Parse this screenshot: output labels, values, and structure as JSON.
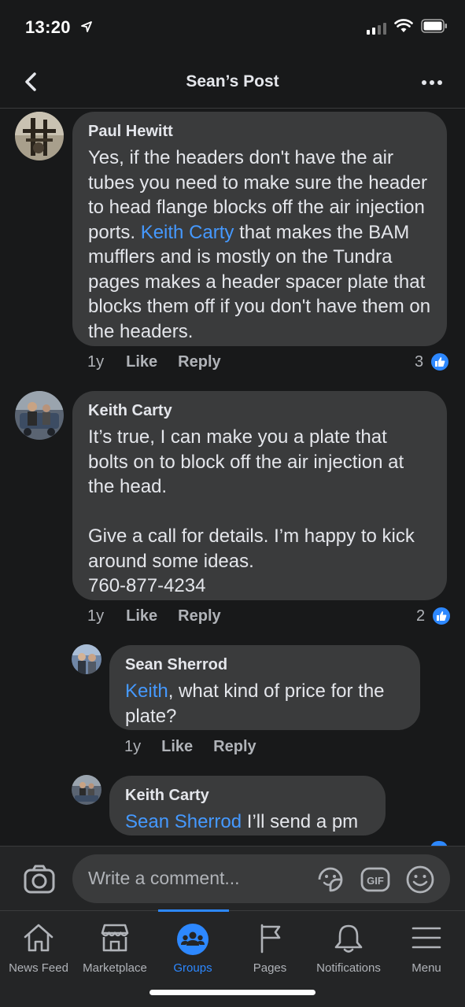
{
  "status_bar": {
    "time": "13:20"
  },
  "header": {
    "title": "Sean’s Post"
  },
  "comments": [
    {
      "author": "Paul Hewitt",
      "text_before": "Yes, if the headers don't have the air tubes you need to make sure the header to head flange blocks off the air injection ports. ",
      "mention": "Keith Carty",
      "text_after": " that makes the BAM mufflers and is mostly on the Tundra pages makes a header spacer plate that blocks them off if you don't have them on the headers.",
      "age": "1y",
      "like_label": "Like",
      "reply_label": "Reply",
      "reaction_count": "3"
    },
    {
      "author": "Keith Carty",
      "text": "It’s true, I can make you a plate that bolts on to block off the air injection at the head.\n\nGive a call for details. I’m happy to kick around some ideas.\n760-877-4234",
      "age": "1y",
      "like_label": "Like",
      "reply_label": "Reply",
      "reaction_count": "2"
    },
    {
      "author": "Sean Sherrod",
      "mention": "Keith",
      "text_after": ", what kind of price for the plate?",
      "age": "1y",
      "like_label": "Like",
      "reply_label": "Reply"
    },
    {
      "author": "Keith Carty",
      "mention": "Sean Sherrod",
      "text_after": " I’ll send a pm"
    }
  ],
  "composer": {
    "placeholder": "Write a comment..."
  },
  "tabs": [
    {
      "label": "News Feed",
      "icon": "home-icon"
    },
    {
      "label": "Marketplace",
      "icon": "marketplace-icon"
    },
    {
      "label": "Groups",
      "icon": "groups-icon",
      "active": true
    },
    {
      "label": "Pages",
      "icon": "flag-icon"
    },
    {
      "label": "Notifications",
      "icon": "bell-icon"
    },
    {
      "label": "Menu",
      "icon": "hamburger-icon"
    }
  ],
  "colors": {
    "background": "#18191a",
    "bubble": "#3a3b3c",
    "accent": "#2d88ff",
    "mention": "#4599ff",
    "secondary_text": "#b0b3b8"
  }
}
